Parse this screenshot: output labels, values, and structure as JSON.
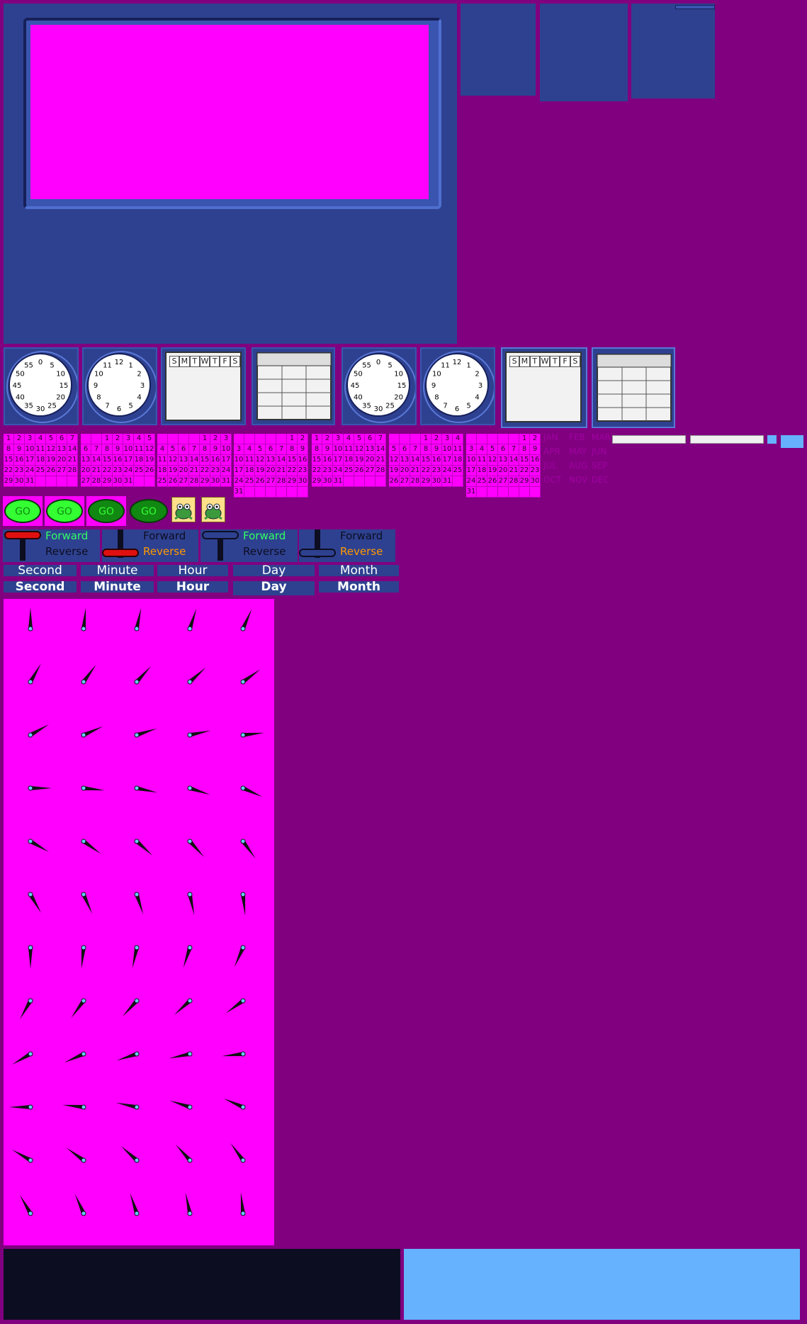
{
  "clock_minute_labels": [
    "0",
    "5",
    "10",
    "15",
    "20",
    "25",
    "30",
    "35",
    "40",
    "45",
    "50",
    "55"
  ],
  "clock_hour_labels": [
    "12",
    "1",
    "2",
    "3",
    "4",
    "5",
    "6",
    "7",
    "8",
    "9",
    "10",
    "11"
  ],
  "week_days": [
    "S",
    "M",
    "T",
    "W",
    "T",
    "F",
    "S"
  ],
  "calendar_offsets": [
    0,
    2,
    4,
    5,
    0,
    3,
    5,
    1
  ],
  "calendar_lengths": [
    31,
    31,
    31,
    31,
    31,
    31,
    31,
    31
  ],
  "months": [
    "JAN",
    "FEB",
    "MAR",
    "APR",
    "MAY",
    "JUN",
    "JUL",
    "AUG",
    "SEP",
    "OCT",
    "NOV",
    "DEC"
  ],
  "go_label": "GO",
  "forward_label": "Forward",
  "reverse_label": "Reverse",
  "time_units": [
    "Second",
    "Minute",
    "Hour",
    "Day",
    "Month"
  ],
  "colors": {
    "background": "#800080",
    "magenta": "#ff00ff",
    "panel_blue": "#2e4190",
    "light_blue": "#66b2ff",
    "dark_navy": "#0d0d22",
    "go_bright": "#33ff33",
    "go_dark": "#118811",
    "forward_green": "#33ff66",
    "reverse_orange": "#ff9900"
  }
}
